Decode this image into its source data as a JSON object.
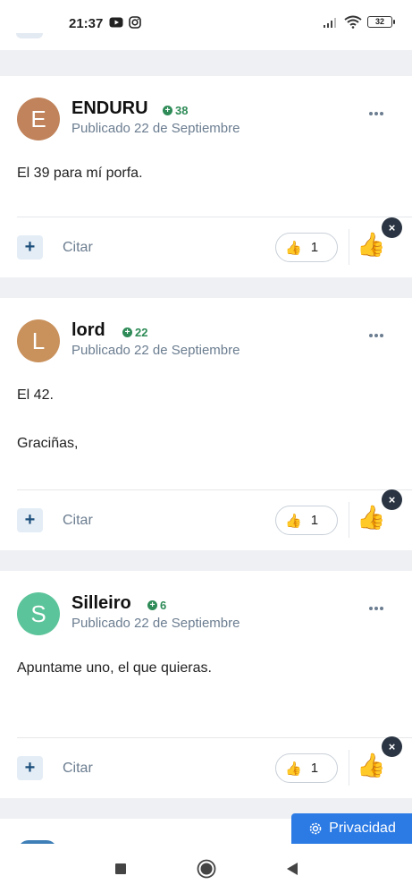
{
  "status_bar": {
    "time": "21:37",
    "battery": "32",
    "icons": [
      "youtube-icon",
      "instagram-icon",
      "signal-icon",
      "wifi-icon",
      "battery-icon"
    ]
  },
  "colors": {
    "reputation": "#2e8b57",
    "accent": "#2c7be5",
    "muted_text": "#6b7d90",
    "close_badge": "#2a3442"
  },
  "posts": [
    {
      "author": "ENDURU",
      "avatar_letter": "E",
      "avatar_color": "#c0835b",
      "reputation": "38",
      "date": "Publicado 22 de Septiembre",
      "content": [
        "El 39 para mí porfa."
      ],
      "cite_label": "Citar",
      "reaction_count": "1",
      "reaction_icon": "thumbs-up",
      "close_label": "×"
    },
    {
      "author": "lord",
      "avatar_letter": "L",
      "avatar_color": "#c9915c",
      "reputation": "22",
      "date": "Publicado 22 de Septiembre",
      "content": [
        "El 42.",
        "Graciñas,"
      ],
      "cite_label": "Citar",
      "reaction_count": "1",
      "reaction_icon": "thumbs-up",
      "close_label": "×"
    },
    {
      "author": "Silleiro",
      "avatar_letter": "S",
      "avatar_color": "#5cc49a",
      "reputation": "6",
      "date": "Publicado 22 de Septiembre",
      "content": [
        "Apuntame uno, el que quieras."
      ],
      "cite_label": "Citar",
      "reaction_count": "1",
      "reaction_icon": "thumbs-up",
      "close_label": "×"
    }
  ],
  "privacy_button": {
    "label": "Privacidad",
    "icon": "gear-icon"
  },
  "nav_bar": {
    "icons": [
      "recents-icon",
      "home-icon",
      "back-icon"
    ]
  }
}
